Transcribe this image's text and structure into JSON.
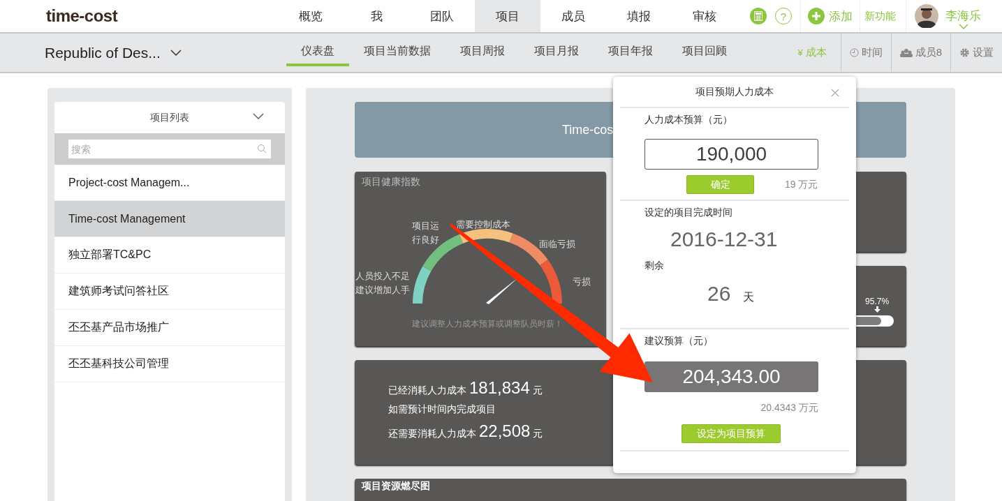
{
  "header": {
    "logo": "time-cost",
    "nav": [
      {
        "label": "概览",
        "selected": false
      },
      {
        "label": "我",
        "selected": false
      },
      {
        "label": "团队",
        "selected": false
      },
      {
        "label": "项目",
        "selected": true
      },
      {
        "label": "成员",
        "selected": false
      },
      {
        "label": "填报",
        "selected": false
      },
      {
        "label": "审核",
        "selected": false
      }
    ],
    "help": "?",
    "add": "添加",
    "new_feature": "新功能",
    "user": "李海乐"
  },
  "subnav": {
    "project": "Republic of Des...",
    "tabs": [
      {
        "label": "仪表盘",
        "selected": true
      },
      {
        "label": "项目当前数据",
        "selected": false
      },
      {
        "label": "项目周报",
        "selected": false
      },
      {
        "label": "项目月报",
        "selected": false
      },
      {
        "label": "项目年报",
        "selected": false
      },
      {
        "label": "项目回顾",
        "selected": false
      }
    ],
    "views": [
      {
        "kind": "cost",
        "symbol": "¥",
        "label": "成本",
        "selected": true
      },
      {
        "kind": "time",
        "label": "时间",
        "selected": false
      },
      {
        "kind": "members",
        "label": "成员8",
        "selected": false
      },
      {
        "kind": "settings",
        "label": "设置",
        "selected": false
      }
    ]
  },
  "project_list": {
    "title": "项目列表",
    "search": {
      "placeholder": "搜索"
    },
    "items": [
      {
        "label": "Project-cost Managem...",
        "selected": false
      },
      {
        "label": "Time-cost Management",
        "selected": true
      },
      {
        "label": "独立部署TC&PC",
        "selected": false
      },
      {
        "label": "建筑师考试问答社区",
        "selected": false
      },
      {
        "label": "丕丕基产品市场推广",
        "selected": false
      },
      {
        "label": "丕丕基科技公司管理",
        "selected": false
      }
    ]
  },
  "banner": {
    "title": "Time-cos"
  },
  "health": {
    "title": "项目健康指数",
    "labels": [
      "项目运",
      "行良好",
      "需要控制成本",
      "面临亏损",
      "亏损",
      "人员投入不足",
      "建议增加人手"
    ],
    "hint": "建议调整人力成本预算或调整队员时薪！"
  },
  "progress": {
    "reading": "95.7%",
    "level": 0.957
  },
  "stats": [
    {
      "label": "已经消耗人力成本",
      "value": "181,834",
      "unit": "元"
    },
    {
      "label": "如需预计时间内完成项目"
    },
    {
      "label": "还需要消耗人力成本",
      "value": "22,508",
      "unit": "元"
    }
  ],
  "burndown": {
    "title": "项目资源燃尽图"
  },
  "popup": {
    "title": "项目预期人力成本",
    "budget_label": "人力成本预算（元）",
    "budget_value": "190,000",
    "confirm": "确定",
    "budget_wan": "19 万元",
    "date_label": "设定的项目完成时间",
    "date": "2016-12-31",
    "remain_label": "剩余",
    "remain_value": "26",
    "remain_unit": "天",
    "suggest_label": "建议预算（元）",
    "suggest_value": "204,343.00",
    "suggest_wan": "20.4343 万元",
    "apply": "设定为项目预算"
  }
}
